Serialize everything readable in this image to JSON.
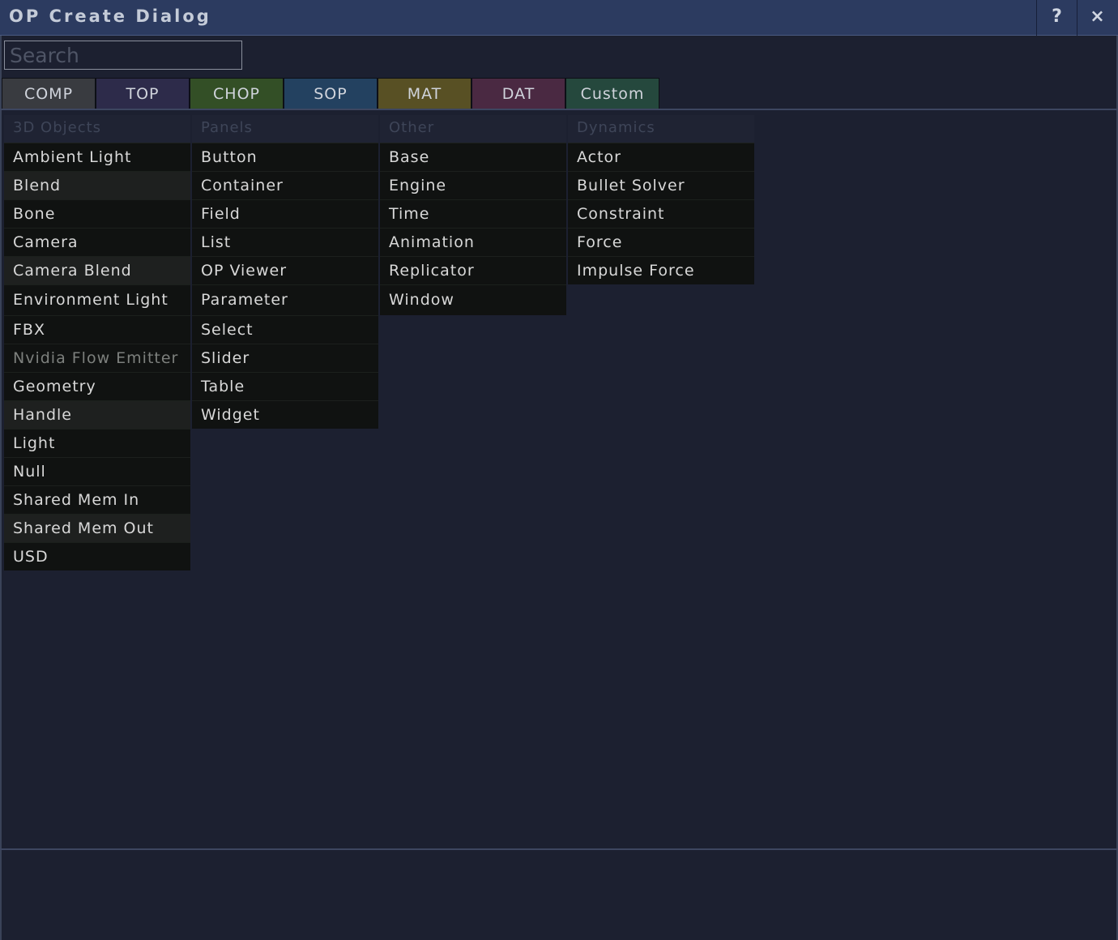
{
  "window": {
    "title": "OP Create Dialog",
    "help_label": "?",
    "close_label": "×"
  },
  "search": {
    "placeholder": "Search",
    "value": ""
  },
  "tabs": [
    {
      "label": "COMP",
      "color": "#393b40",
      "active": true
    },
    {
      "label": "TOP",
      "color": "#2d2b4a"
    },
    {
      "label": "CHOP",
      "color": "#334f26"
    },
    {
      "label": "SOP",
      "color": "#234160"
    },
    {
      "label": "MAT",
      "color": "#585024"
    },
    {
      "label": "DAT",
      "color": "#4a2942"
    },
    {
      "label": "Custom",
      "color": "#25483d"
    }
  ],
  "columns": [
    {
      "header": "3D Objects",
      "items": [
        "Ambient Light",
        "Blend",
        "Bone",
        "Camera",
        "Camera Blend",
        "Environment Light",
        "FBX",
        "Nvidia Flow Emitter",
        "Geometry",
        "Handle",
        "Light",
        "Null",
        "Shared Mem In",
        "Shared Mem Out",
        "USD"
      ]
    },
    {
      "header": "Panels",
      "items": [
        "Button",
        "Container",
        "Field",
        "List",
        "OP Viewer",
        "Parameter",
        "Select",
        "Slider",
        "Table",
        "Widget"
      ]
    },
    {
      "header": "Other",
      "items": [
        "Base",
        "Engine",
        "Time",
        "Animation",
        "Replicator",
        "Window"
      ]
    },
    {
      "header": "Dynamics",
      "items": [
        "Actor",
        "Bullet Solver",
        "Constraint",
        "Force",
        "Impulse Force"
      ]
    }
  ]
}
